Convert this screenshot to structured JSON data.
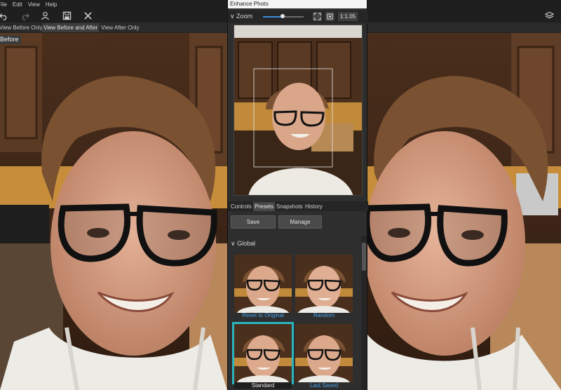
{
  "menu": [
    "File",
    "Edit",
    "View",
    "Help"
  ],
  "toolbar": {
    "icons": [
      "undo-icon",
      "redo-icon",
      "person-icon",
      "save-icon",
      "close-icon",
      "layers-icon"
    ]
  },
  "viewbar": {
    "before_only": "View Before Only",
    "before_after": "View Before and After",
    "after_only": "View After Only"
  },
  "before_label": "Before",
  "dialog": {
    "title": "Enhance Photo",
    "zoom": {
      "label": "Zoom",
      "value": "1:1.05",
      "level": 0.48
    },
    "tabs": [
      "Controls",
      "Presets",
      "Snapshots",
      "History"
    ],
    "active_tab": "Presets",
    "save_label": "Save",
    "manage_label": "Manage",
    "section": "Global",
    "presets": [
      "Reset to Original",
      "Random",
      "Standard",
      "Last Saved"
    ],
    "selected_preset": "Standard"
  },
  "colors": {
    "accent": "#3b8fd8",
    "selection": "#2ab4bf",
    "link": "#4aa3e6"
  }
}
